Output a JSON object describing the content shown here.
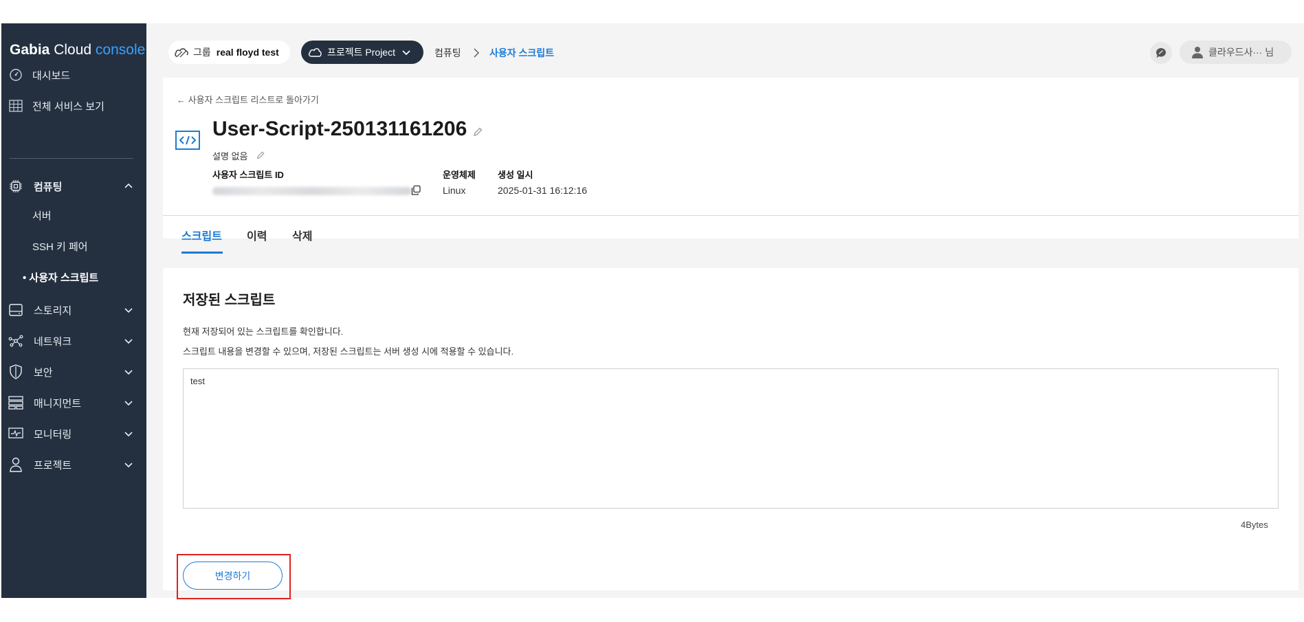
{
  "logo": {
    "brand": "Gabia",
    "product": "Cloud",
    "suffix": "console"
  },
  "sidebar": {
    "top_items": [
      {
        "label": "대시보드",
        "icon": "dashboard-icon"
      },
      {
        "label": "전체 서비스 보기",
        "icon": "grid-icon"
      }
    ],
    "computing": {
      "label": "컴퓨팅",
      "icon": "chip-icon",
      "expanded": true,
      "children": [
        {
          "label": "서버"
        },
        {
          "label": "SSH 키 페어"
        },
        {
          "label": "• 사용자 스크립트",
          "active": true
        }
      ]
    },
    "groups": [
      {
        "label": "스토리지",
        "icon": "storage-icon"
      },
      {
        "label": "네트워크",
        "icon": "network-icon"
      },
      {
        "label": "보안",
        "icon": "shield-icon"
      },
      {
        "label": "매니지먼트",
        "icon": "management-icon"
      },
      {
        "label": "모니터링",
        "icon": "monitor-icon"
      },
      {
        "label": "프로젝트",
        "icon": "user-icon"
      }
    ]
  },
  "topbar": {
    "group_key": "그룹",
    "group_value": "real floyd test",
    "project_label": "프로젝트 Project",
    "breadcrumb": [
      "컴퓨팅",
      "사용자 스크립트"
    ],
    "user_label": "클라우드사··· 님"
  },
  "header": {
    "back_link": "← 사용자 스크립트 리스트로 돌아가기",
    "title": "User-Script-250131161206",
    "description": "설명 없음",
    "meta": {
      "id_label": "사용자 스크립트 ID",
      "os_label": "운영체제",
      "os_value": "Linux",
      "created_label": "생성 일시",
      "created_value": "2025-01-31 16:12:16"
    }
  },
  "tabs": [
    {
      "label": "스크립트",
      "active": true
    },
    {
      "label": "이력"
    },
    {
      "label": "삭제"
    }
  ],
  "content": {
    "section_title": "저장된 스크립트",
    "line1": "현재 저장되어 있는 스크립트를 확인합니다.",
    "line2": "스크립트 내용을 변경할 수 있으며, 저장된 스크립트는 서버 생성 시에 적용할 수 있습니다.",
    "script_value": "test",
    "size": "4Bytes",
    "change_button": "변경하기"
  },
  "colors": {
    "sidebar_bg": "#243040",
    "accent": "#1a7bd6",
    "highlight": "#e0201c"
  }
}
